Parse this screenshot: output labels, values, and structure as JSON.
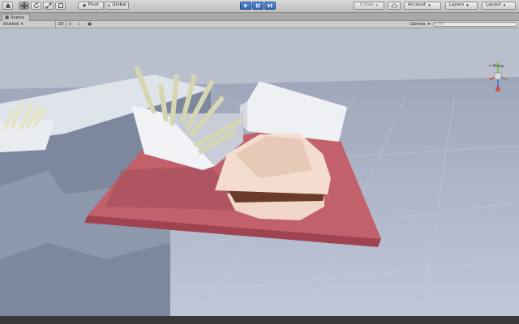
{
  "toolbar": {
    "tools": [
      "hand-tool",
      "move-tool",
      "rotate-tool",
      "scale-tool",
      "rect-tool"
    ],
    "pivot_label": "Pivot",
    "global_label": "Global",
    "collab_label": "Collab",
    "account_label": "Account",
    "layers_label": "Layers",
    "layout_label": "Layout"
  },
  "tab": {
    "title": "Scene"
  },
  "scenebar": {
    "shading_mode": "Shaded",
    "dim_label": "2D",
    "gizmos_label": "Gizmos",
    "search_placeholder": "All"
  },
  "viewport": {
    "projection_label": "< Persp",
    "colors": {
      "tray": "#c2606b",
      "fries": "#d6d6b2",
      "bun": "#f1d9cb",
      "cup": "#f4f4f6",
      "floor": "#aeb6c8"
    }
  }
}
